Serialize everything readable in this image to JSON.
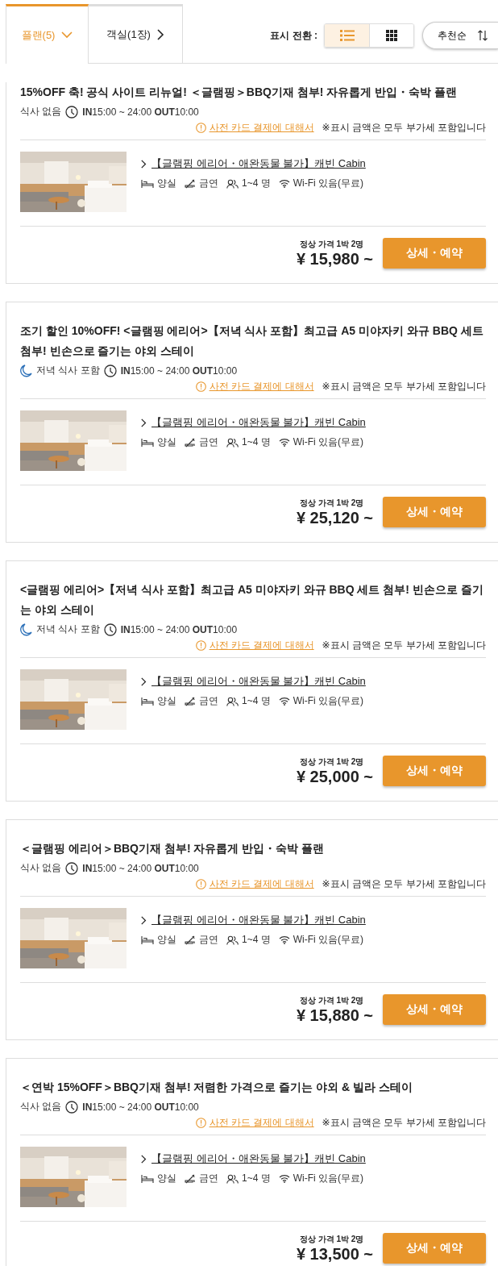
{
  "tabs": [
    {
      "label": "플랜(5)",
      "selected": true,
      "kind": "dropdown"
    },
    {
      "label": "객실(1장)",
      "selected": false,
      "kind": "link"
    }
  ],
  "view_toggle": {
    "label": "표시 전환 :",
    "options": [
      {
        "kind": "list",
        "selected": true
      },
      {
        "kind": "grid",
        "selected": false
      }
    ]
  },
  "sort": {
    "label": "추천순"
  },
  "plans": [
    {
      "title": "15%OFF 축! 공식 사이트 리뉴얼! ＜글램핑＞BBQ기재 첨부! 자유롭게 반입・숙박 플랜",
      "meal": {
        "kind": "none",
        "label": "식사 없음"
      },
      "checkin": "**IN**15:00 ~ 24:00 **OUT**10:00",
      "card_link": "사전 카드 결제에 대해서",
      "tax_note": "※표시 금액은 모두 부가세 포함입니다",
      "room": {
        "name": "【글램핑 에리어・애완동물 불가】캐빈 Cabin",
        "bed": "양실",
        "smoking": "금연",
        "capacity": "1~4 명",
        "wifi": "Wi-Fi 있음(무료)"
      },
      "price_label": "정상 가격 1박 2명",
      "price": "¥ 15,980 ~",
      "button": "상세・예약"
    },
    {
      "title": "조기 할인 10%OFF! <글램핑 에리어>【저녁 식사 포함】최고급 A5 미야자키 와규 BBQ 세트 첨부! 빈손으로 즐기는 야외 스테이",
      "meal": {
        "kind": "dinner",
        "label": "저녁 식사 포함"
      },
      "checkin": "**IN**15:00 ~ 24:00 **OUT**10:00",
      "card_link": "사전 카드 결제에 대해서",
      "tax_note": "※표시 금액은 모두 부가세 포함입니다",
      "room": {
        "name": "【글램핑 에리어・애완동물 불가】캐빈 Cabin",
        "bed": "양실",
        "smoking": "금연",
        "capacity": "1~4 명",
        "wifi": "Wi-Fi 있음(무료)"
      },
      "price_label": "정상 가격 1박 2명",
      "price": "¥ 25,120 ~",
      "button": "상세・예약"
    },
    {
      "title": "<글램핑 에리어>【저녁 식사 포함】최고급 A5 미야자키 와규 BBQ 세트 첨부! 빈손으로 즐기는 야외 스테이",
      "meal": {
        "kind": "dinner",
        "label": "저녁 식사 포함"
      },
      "checkin": "**IN**15:00 ~ 24:00 **OUT**10:00",
      "card_link": "사전 카드 결제에 대해서",
      "tax_note": "※표시 금액은 모두 부가세 포함입니다",
      "room": {
        "name": "【글램핑 에리어・애완동물 불가】캐빈 Cabin",
        "bed": "양실",
        "smoking": "금연",
        "capacity": "1~4 명",
        "wifi": "Wi-Fi 있음(무료)"
      },
      "price_label": "정상 가격 1박 2명",
      "price": "¥ 25,000 ~",
      "button": "상세・예약"
    },
    {
      "title": "＜글램핑 에리어＞BBQ기재 첨부! 자유롭게 반입・숙박 플랜",
      "meal": {
        "kind": "none",
        "label": "식사 없음"
      },
      "checkin": "**IN**15:00 ~ 24:00 **OUT**10:00",
      "card_link": "사전 카드 결제에 대해서",
      "tax_note": "※표시 금액은 모두 부가세 포함입니다",
      "room": {
        "name": "【글램핑 에리어・애완동물 불가】캐빈 Cabin",
        "bed": "양실",
        "smoking": "금연",
        "capacity": "1~4 명",
        "wifi": "Wi-Fi 있음(무료)"
      },
      "price_label": "정상 가격 1박 2명",
      "price": "¥ 15,880 ~",
      "button": "상세・예약"
    },
    {
      "title": "＜연박 15%OFF＞BBQ기재 첨부! 저렴한 가격으로 즐기는 야외 & 빌라 스테이",
      "meal": {
        "kind": "none",
        "label": "식사 없음"
      },
      "checkin": "**IN**15:00 ~ 24:00 **OUT**10:00",
      "card_link": "사전 카드 결제에 대해서",
      "tax_note": "※표시 금액은 모두 부가세 포함입니다",
      "room": {
        "name": "【글램핑 에리어・애완동물 불가】캐빈 Cabin",
        "bed": "양실",
        "smoking": "금연",
        "capacity": "1~4 명",
        "wifi": "Wi-Fi 있음(무료)"
      },
      "price_label": "정상 가격 1박 2명",
      "price": "¥ 13,500 ~",
      "button": "상세・예약"
    }
  ]
}
